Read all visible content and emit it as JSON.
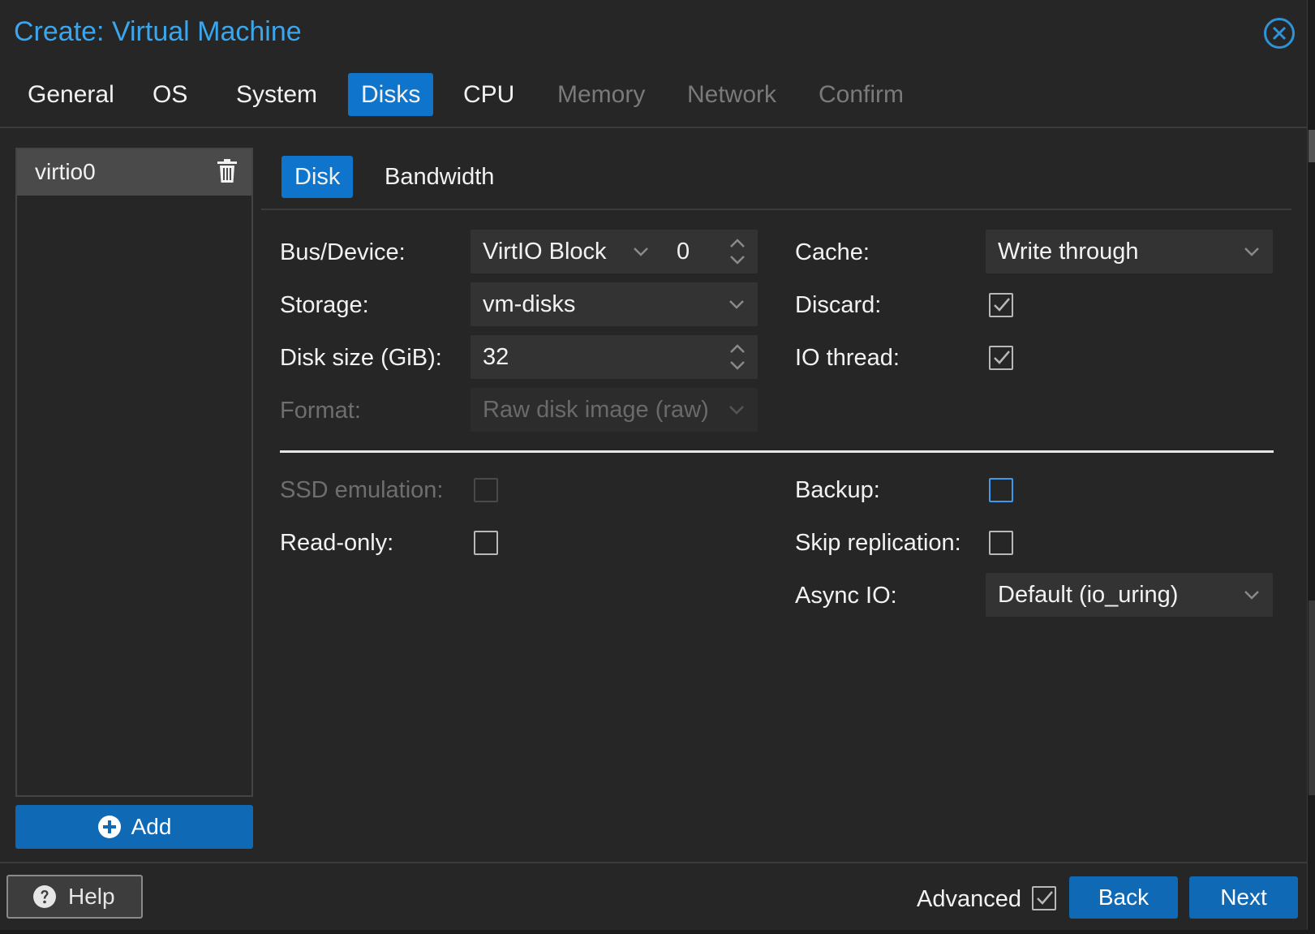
{
  "window": {
    "title": "Create: Virtual Machine"
  },
  "tabs": [
    {
      "label": "General",
      "state": "normal"
    },
    {
      "label": "OS",
      "state": "normal"
    },
    {
      "label": "System",
      "state": "normal"
    },
    {
      "label": "Disks",
      "state": "active"
    },
    {
      "label": "CPU",
      "state": "normal"
    },
    {
      "label": "Memory",
      "state": "disabled"
    },
    {
      "label": "Network",
      "state": "disabled"
    },
    {
      "label": "Confirm",
      "state": "disabled"
    }
  ],
  "disk_list": {
    "items": [
      {
        "label": "virtio0",
        "icon": "trash-icon"
      }
    ],
    "add_label": "Add"
  },
  "subtabs": [
    {
      "label": "Disk",
      "state": "active"
    },
    {
      "label": "Bandwidth",
      "state": "normal"
    }
  ],
  "form": {
    "bus_device": {
      "label": "Bus/Device:",
      "bus": "VirtIO Block",
      "device": "0"
    },
    "storage": {
      "label": "Storage:",
      "value": "vm-disks"
    },
    "disk_size": {
      "label": "Disk size (GiB):",
      "value": "32"
    },
    "format": {
      "label": "Format:",
      "value": "Raw disk image (raw)"
    },
    "cache": {
      "label": "Cache:",
      "value": "Write through"
    },
    "discard": {
      "label": "Discard:",
      "checked": true
    },
    "io_thread": {
      "label": "IO thread:",
      "checked": true
    },
    "ssd_emulation": {
      "label": "SSD emulation:",
      "checked": false,
      "disabled": true
    },
    "read_only": {
      "label": "Read-only:",
      "checked": false
    },
    "backup": {
      "label": "Backup:",
      "checked": false
    },
    "skip_replication": {
      "label": "Skip replication:",
      "checked": false
    },
    "async_io": {
      "label": "Async IO:",
      "value": "Default (io_uring)"
    }
  },
  "footer": {
    "help_label": "Help",
    "advanced_label": "Advanced",
    "advanced_checked": true,
    "back_label": "Back",
    "next_label": "Next"
  },
  "colors": {
    "accent": "#0f75cc",
    "title": "#39a6ee",
    "background": "#262626"
  }
}
